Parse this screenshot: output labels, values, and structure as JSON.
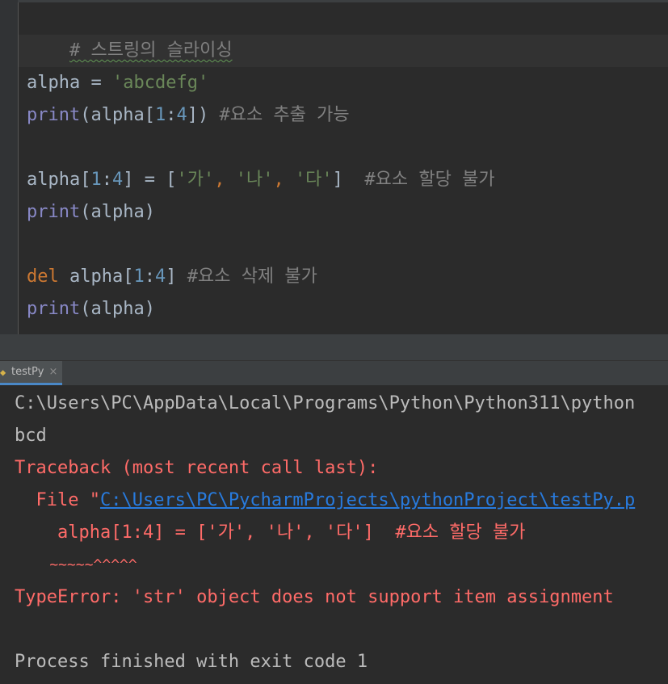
{
  "editor": {
    "lines": [
      {
        "comment": "# 스트링의 슬라이싱"
      },
      {},
      {
        "var": "alpha",
        "op": " = ",
        "str": "'abcdefg'"
      },
      {
        "func": "print",
        "open": "(alpha[",
        "n1": "1",
        "colon": ":",
        "n2": "4",
        "close": "]) ",
        "comment": "#요소 추출 가능"
      },
      {},
      {
        "pre": "alpha[",
        "n1": "1",
        "colon": ":",
        "n2": "4",
        "mid": "] = [",
        "s1": "'가'",
        "c1": ", ",
        "s2": "'나'",
        "c2": ", ",
        "s3": "'다'",
        "end": "]  ",
        "comment": "#요소 할당 불가"
      },
      {
        "func": "print",
        "args": "(alpha)"
      },
      {},
      {
        "kw": "del",
        "rest": " alpha[",
        "n1": "1",
        "colon": ":",
        "n2": "4",
        "close": "] ",
        "comment": "#요소 삭제 불가"
      },
      {
        "func": "print",
        "args": "(alpha)"
      }
    ]
  },
  "run_tab": {
    "label": "testPy",
    "close": "×",
    "icon": "python-file-icon"
  },
  "console": {
    "path_line": "C:\\Users\\PC\\AppData\\Local\\Programs\\Python\\Python311\\python",
    "output": "bcd",
    "traceback": "Traceback (most recent call last):",
    "file_prefix": "  File \"",
    "file_link": "C:\\Users\\PC\\PycharmProjects\\pythonProject\\testPy.p",
    "code_line": "    alpha[1:4] = ['가', '나', '다']  #요소 할당 불가",
    "caret_line": "    ~~~~~^^^^^",
    "error": "TypeError: 'str' object does not support item assignment",
    "finished": "Process finished with exit code 1"
  },
  "colors": {
    "error": "#ff6b68",
    "link": "#287bde",
    "keyword": "#cc7832",
    "string": "#6a8759",
    "number": "#6897bb",
    "builtin": "#8888c6",
    "comment": "#808080"
  }
}
